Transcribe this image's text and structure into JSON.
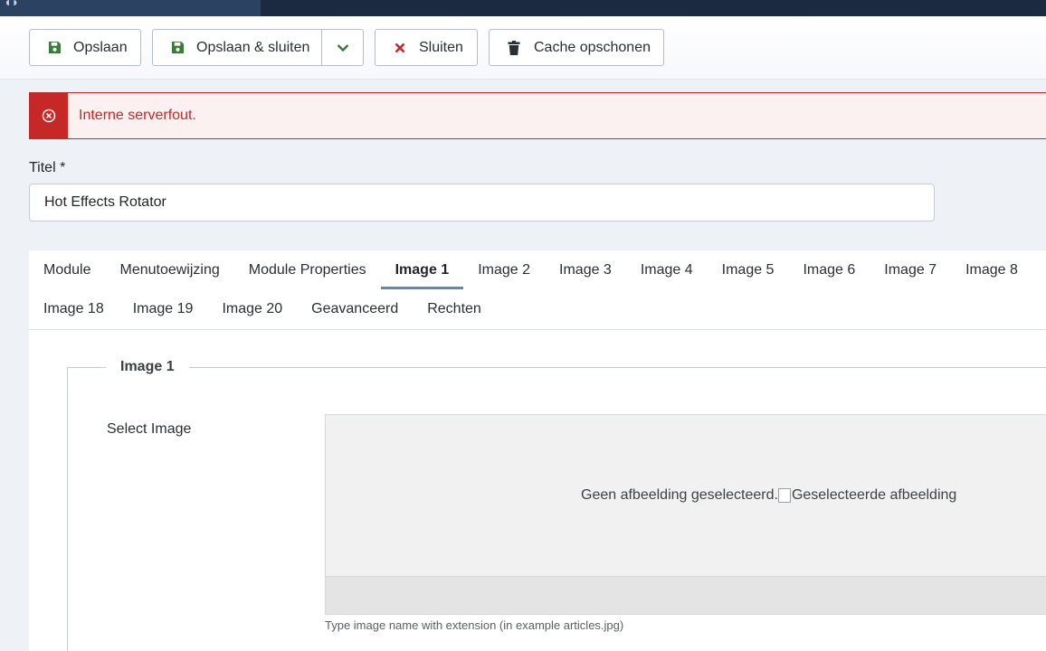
{
  "toolbar": {
    "save_label": "Opslaan",
    "save_close_label": "Opslaan & sluiten",
    "close_label": "Sluiten",
    "cache_label": "Cache opschonen"
  },
  "alert": {
    "message": "Interne serverfout."
  },
  "form": {
    "title_label": "Titel *",
    "title_value": "Hot Effects Rotator"
  },
  "tabs": {
    "row1": [
      "Module",
      "Menutoewijzing",
      "Module Properties",
      "Image 1",
      "Image 2",
      "Image 3",
      "Image 4",
      "Image 5",
      "Image 6",
      "Image 7",
      "Image 8"
    ],
    "row2": [
      "Image 18",
      "Image 19",
      "Image 20",
      "Geavanceerd",
      "Rechten"
    ],
    "active": "Image 1"
  },
  "fieldset": {
    "legend": "Image 1",
    "select_image_label": "Select Image",
    "preview_empty_text": "Geen afbeelding geselecteerd.",
    "preview_alt_text": "Geselecteerde afbeelding",
    "help_text": "Type image name with extension (in example articles.jpg)"
  },
  "colors": {
    "danger": "#c52827",
    "save_icon": "#3c7a3d",
    "close_icon": "#c52827",
    "active_tab_underline": "#5b87b8",
    "topbar": "#1c2a41"
  },
  "icons": {
    "save": "floppy-disk-icon",
    "dropdown": "chevron-down-icon",
    "close": "x-icon",
    "cache": "trash-icon",
    "alert": "circle-x-icon"
  }
}
